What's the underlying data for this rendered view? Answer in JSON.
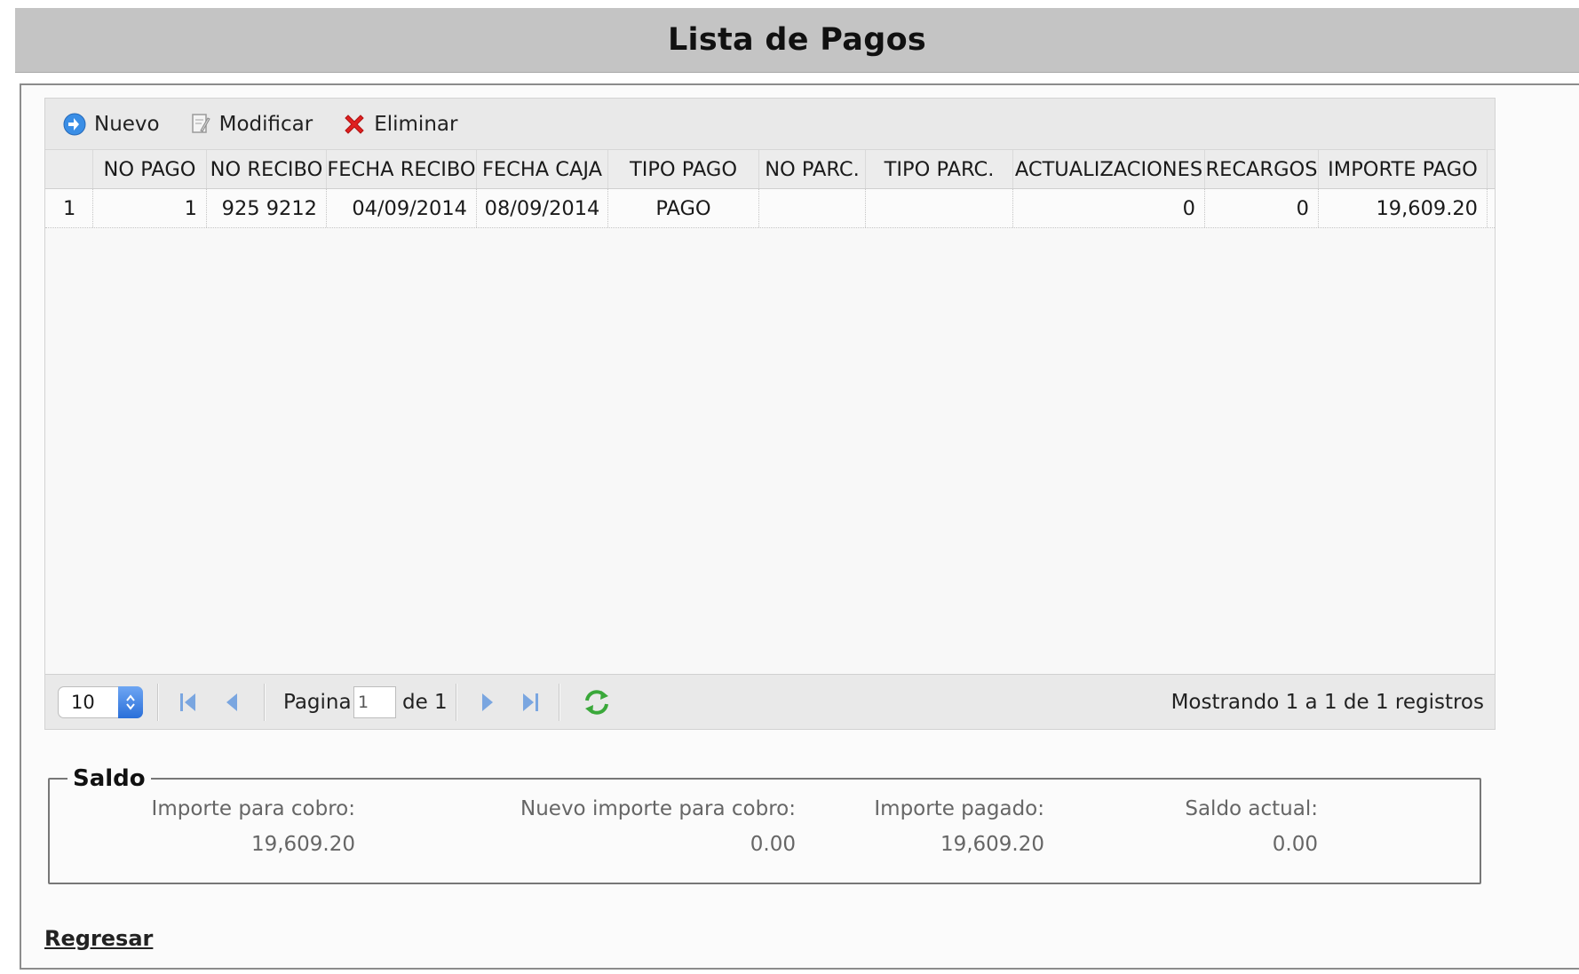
{
  "page": {
    "title": "Lista de Pagos"
  },
  "toolbar": {
    "new_label": "Nuevo",
    "edit_label": "Modificar",
    "delete_label": "Eliminar"
  },
  "table": {
    "columns": [
      "NO PAGO",
      "NO RECIBO",
      "FECHA RECIBO",
      "FECHA CAJA",
      "TIPO PAGO",
      "NO PARC.",
      "TIPO PARC.",
      "ACTUALIZACIONES",
      "RECARGOS",
      "IMPORTE PAGO"
    ],
    "rows": [
      {
        "row_num": "1",
        "no_pago": "1",
        "no_recibo": "925 9212",
        "fecha_recibo": "04/09/2014",
        "fecha_caja": "08/09/2014",
        "tipo_pago": "PAGO",
        "no_parc": "",
        "tipo_parc": "",
        "actualizaciones": "0",
        "recargos": "0",
        "importe_pago": "19,609.20"
      }
    ]
  },
  "pager": {
    "page_size": "10",
    "page_label": "Pagina",
    "current_page": "1",
    "of_label": "de 1",
    "status": "Mostrando 1 a 1 de 1 registros"
  },
  "saldo": {
    "legend": "Saldo",
    "importe_cobro_label": "Importe para cobro:",
    "importe_cobro_value": "19,609.20",
    "nuevo_importe_label": "Nuevo importe para cobro:",
    "nuevo_importe_value": "0.00",
    "importe_pagado_label": "Importe pagado:",
    "importe_pagado_value": "19,609.20",
    "saldo_actual_label": "Saldo actual:",
    "saldo_actual_value": "0.00"
  },
  "footer": {
    "back_link": "Regresar"
  },
  "colors": {
    "title_bar": "#c4c4c4",
    "delete_icon": "#e02020",
    "new_icon": "#3a8ee6",
    "refresh_icon": "#3aa83a",
    "nav_arrow": "#7aa6e0"
  },
  "icons": [
    "add-circle-icon",
    "edit-document-icon",
    "delete-x-icon",
    "first-page-icon",
    "prev-page-icon",
    "next-page-icon",
    "last-page-icon",
    "refresh-icon",
    "stepper-icon"
  ]
}
